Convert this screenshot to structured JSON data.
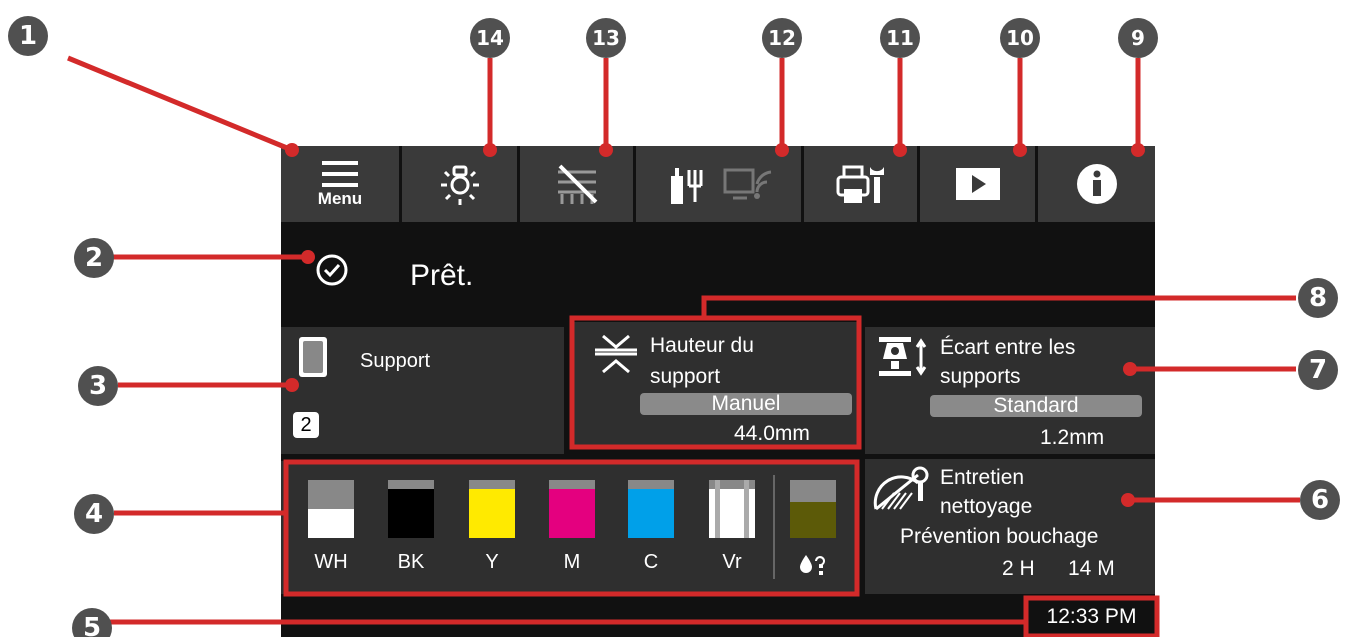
{
  "topbar": {
    "menu_label": "Menu",
    "buttons": [
      "menu-button",
      "light-button",
      "heater-button",
      "network-button",
      "maintenance-button",
      "video-button",
      "info-button"
    ]
  },
  "status": {
    "text": "Prêt."
  },
  "media": {
    "label": "Support",
    "slot": "2"
  },
  "platen": {
    "title_line1": "Hauteur du",
    "title_line2": "support",
    "mode": "Manuel",
    "value": "44.0mm"
  },
  "gap": {
    "title_line1": "Écart entre les",
    "title_line2": "supports",
    "mode": "Standard",
    "value": "1.2mm"
  },
  "maintenance": {
    "title_line1": "Entretien",
    "title_line2": "nettoyage",
    "subtitle": "Prévention bouchage",
    "hours": "2 H",
    "minutes": "14 M"
  },
  "inks": [
    {
      "name": "WH",
      "color": "#ffffff",
      "level": 0.5
    },
    {
      "name": "BK",
      "color": "#000000",
      "level": 0.85
    },
    {
      "name": "Y",
      "color": "#ffea00",
      "level": 0.85
    },
    {
      "name": "M",
      "color": "#e4007f",
      "level": 0.85
    },
    {
      "name": "C",
      "color": "#00a0e9",
      "level": 0.85
    },
    {
      "name": "Vr",
      "color": "#ffffff",
      "level": 0.85
    }
  ],
  "waste_ink": {
    "color": "#5c5a08",
    "level": 0.62
  },
  "clock": "12:33 PM",
  "callouts": [
    "1",
    "2",
    "3",
    "4",
    "5",
    "6",
    "7",
    "8",
    "9",
    "10",
    "11",
    "12",
    "13",
    "14"
  ],
  "colors": {
    "screen_bg": "#111111",
    "tile_bg": "#2f2f2f",
    "button_bg": "#3a3a3a",
    "callout_line": "#d32a2a",
    "callout_badge": "#505050"
  }
}
